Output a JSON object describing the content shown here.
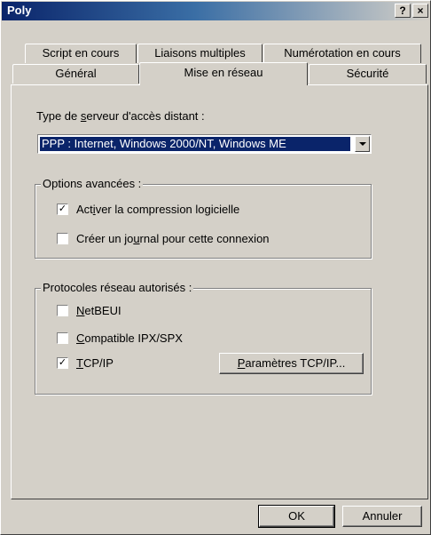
{
  "window": {
    "title": "Poly"
  },
  "titlebar_buttons": {
    "help": "?",
    "close": "×"
  },
  "tabs": {
    "row1": [
      "Script en cours",
      "Liaisons multiples",
      "Numérotation en cours"
    ],
    "row2": [
      "Général",
      "Mise en réseau",
      "Sécurité"
    ],
    "active": "Mise en réseau"
  },
  "server_type": {
    "label_pre": "Type de ",
    "label_key": "s",
    "label_post": "erveur d'accès distant :",
    "selected": "PPP : Internet, Windows 2000/NT, Windows ME"
  },
  "advanced": {
    "title": "Options avancées :",
    "compression": {
      "pre": "Act",
      "key": "i",
      "post": "ver la compression logicielle",
      "checked": true
    },
    "journal": {
      "pre": "Créer un jo",
      "key": "u",
      "post": "rnal pour cette connexion",
      "checked": false
    }
  },
  "protocols": {
    "title": "Protocoles réseau autorisés :",
    "netbeui": {
      "pre": "",
      "key": "N",
      "post": "etBEUI",
      "checked": false
    },
    "ipx": {
      "pre": "",
      "key": "C",
      "post": "ompatible IPX/SPX",
      "checked": false
    },
    "tcpip": {
      "pre": "",
      "key": "T",
      "post": "CP/IP",
      "checked": true
    },
    "settings_button": {
      "pre": "",
      "key": "P",
      "post": "aramètres TCP/IP..."
    }
  },
  "footer": {
    "ok": "OK",
    "cancel": "Annuler"
  },
  "check_mark": "✓"
}
